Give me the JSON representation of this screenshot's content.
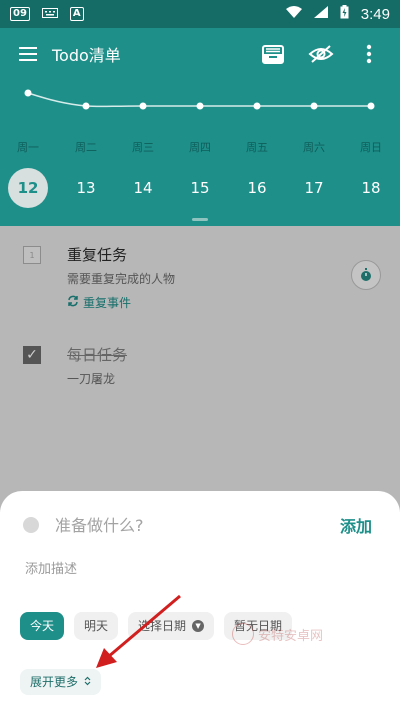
{
  "status_bar": {
    "badge": "09",
    "a_badge": "A",
    "time": "3:49"
  },
  "toolbar": {
    "title": "Todo清单"
  },
  "week": {
    "days": [
      "周一",
      "周二",
      "周三",
      "周四",
      "周五",
      "周六",
      "周日"
    ],
    "dates": [
      "12",
      "13",
      "14",
      "15",
      "16",
      "17",
      "18"
    ],
    "selected_date": "12"
  },
  "tasks": [
    {
      "title": "重复任务",
      "description": "需要重复完成的人物",
      "repeat_label": "重复事件",
      "checkbox_label": "1",
      "completed": false
    },
    {
      "title": "每日任务",
      "description": "一刀屠龙",
      "completed": true
    }
  ],
  "add_sheet": {
    "title_placeholder": "准备做什么?",
    "add_label": "添加",
    "description_placeholder": "添加描述",
    "chips": {
      "today": "今天",
      "tomorrow": "明天",
      "choose_date": "选择日期",
      "no_date": "暂无日期"
    },
    "expand_more": "展开更多",
    "expand_icon": "⌃⌄"
  },
  "watermark": {
    "text": "安特安卓网"
  },
  "colors": {
    "header": "#1f8f8a",
    "status_bar": "#156b66",
    "accent": "#1f8f8a",
    "annotation_arrow": "#d11f1f"
  }
}
